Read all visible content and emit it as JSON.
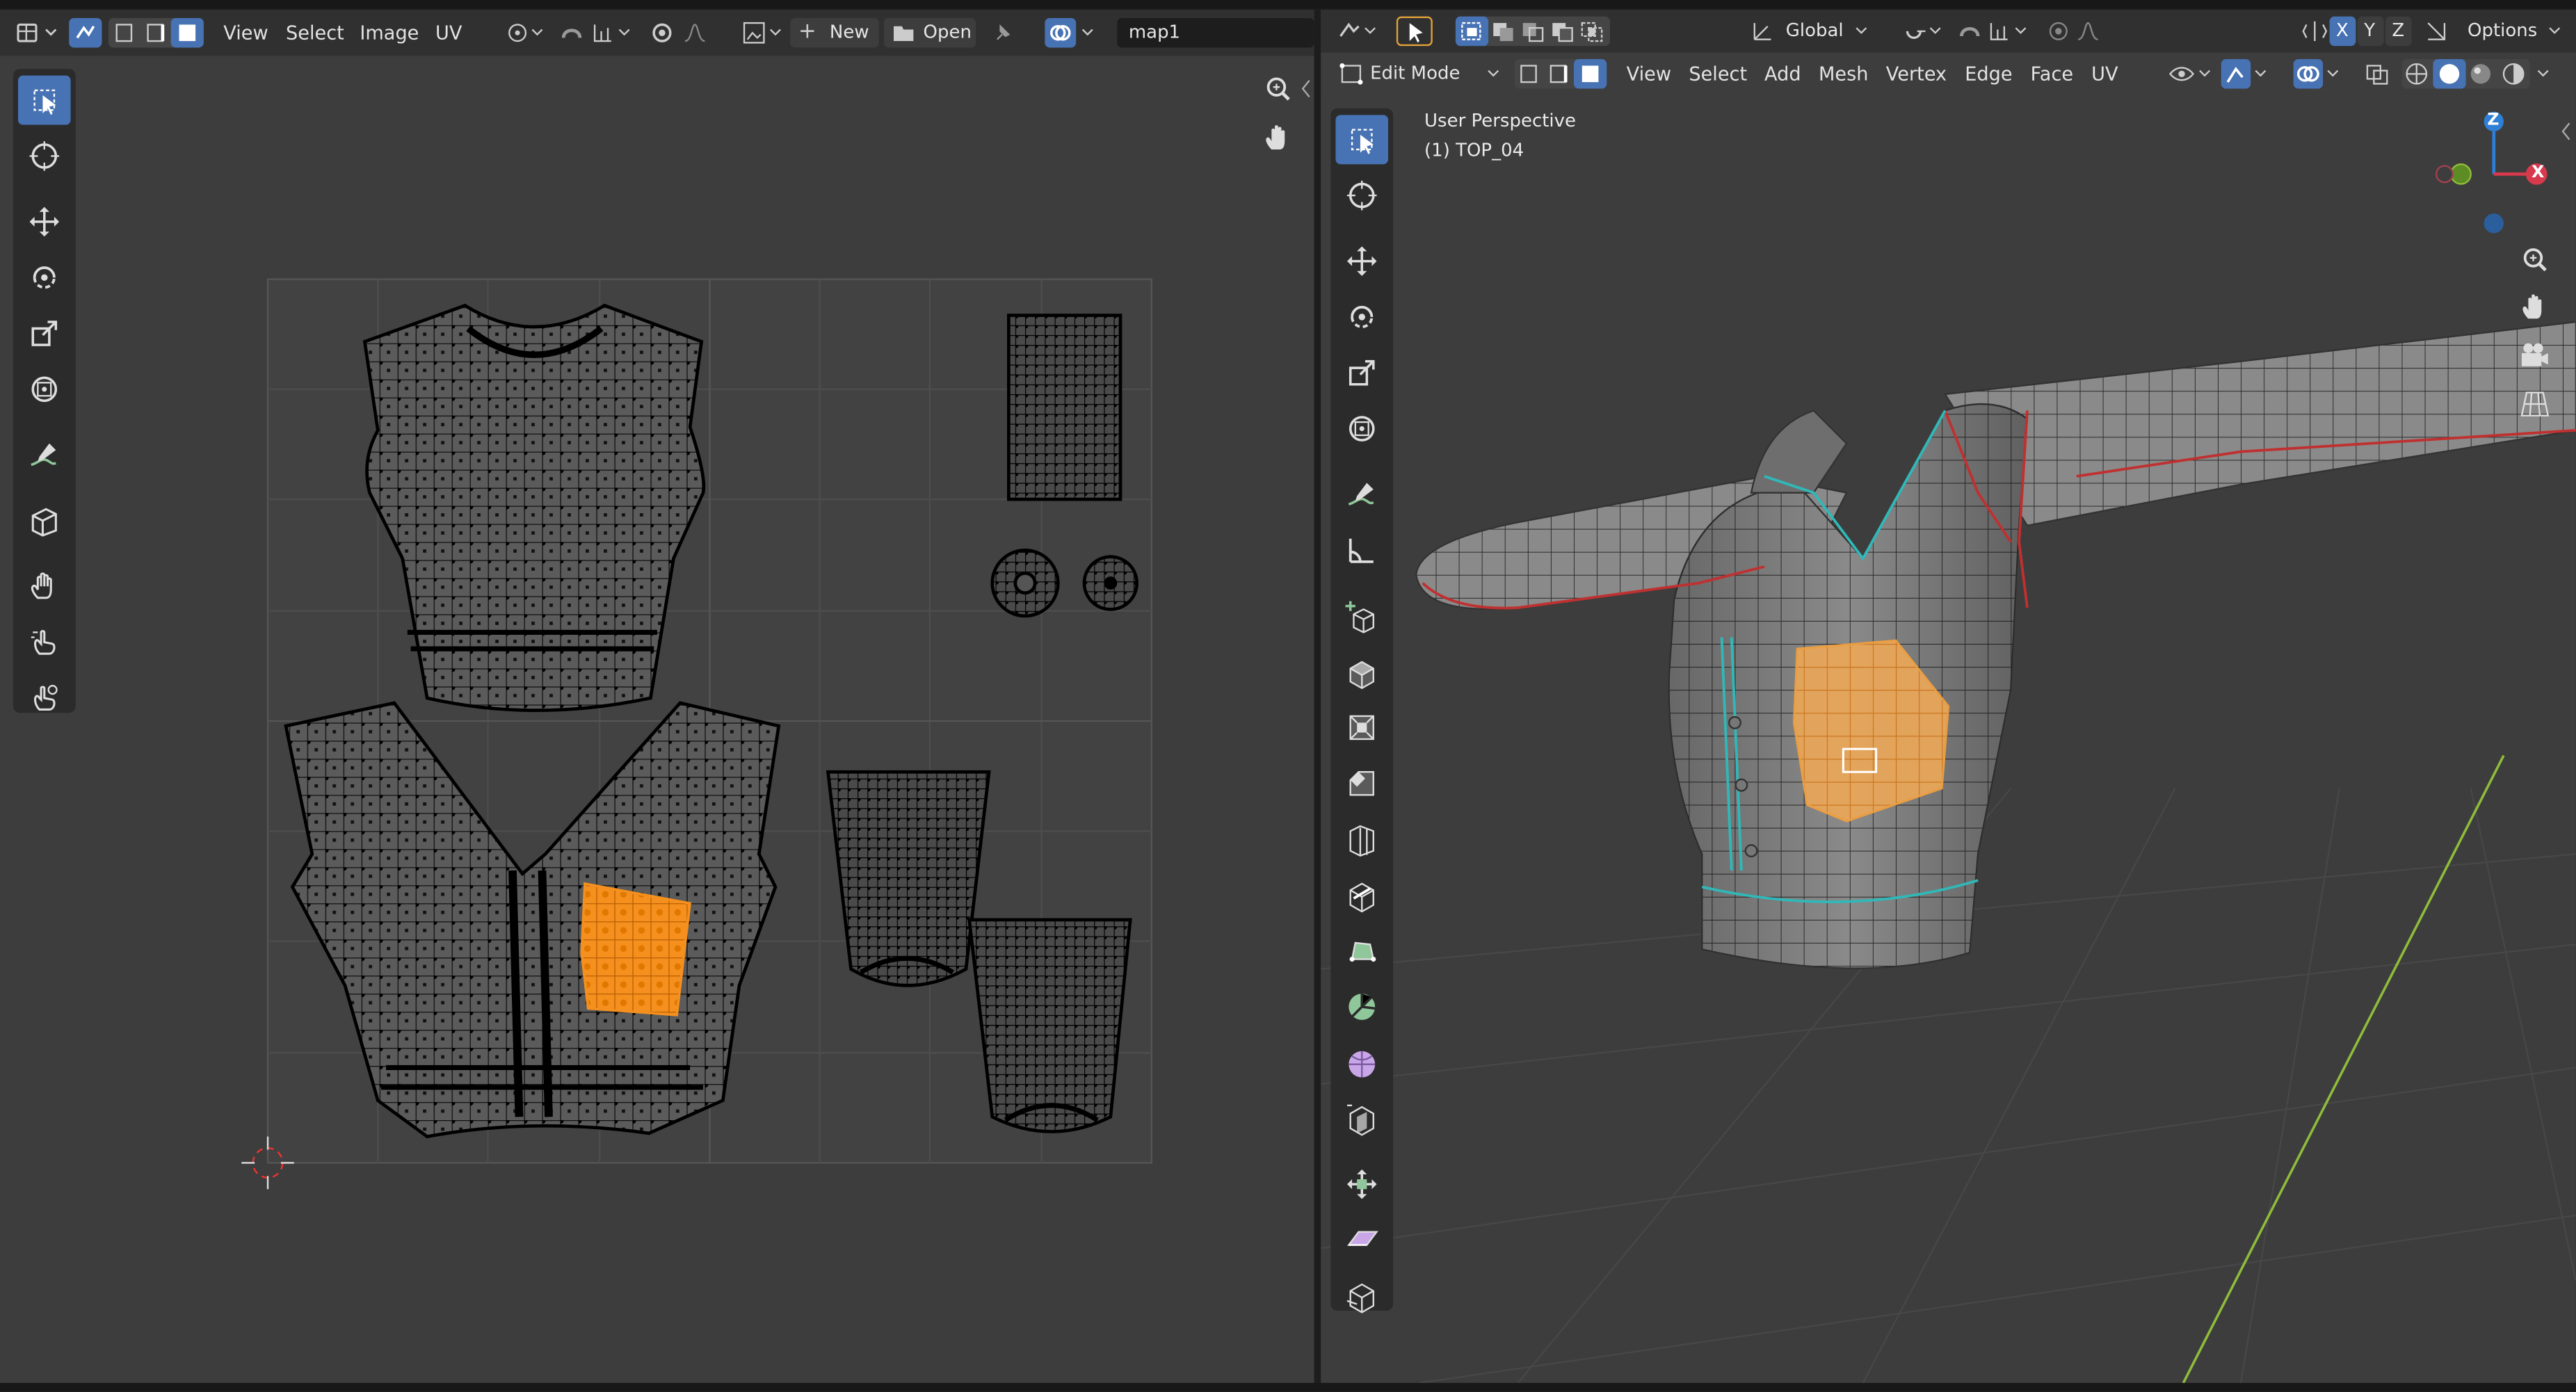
{
  "uv_editor": {
    "menus": [
      "View",
      "Select",
      "Image",
      "UV"
    ],
    "new_label": "New",
    "open_label": "Open",
    "image_name": "map1",
    "tools": [
      "select-box",
      "cursor",
      "move",
      "rotate",
      "scale",
      "transform",
      "annotate",
      "rip-region",
      "grab",
      "relax",
      "pinch"
    ]
  },
  "viewport": {
    "mode_label": "Edit Mode",
    "menus": [
      "View",
      "Select",
      "Add",
      "Mesh",
      "Vertex",
      "Edge",
      "Face",
      "UV"
    ],
    "orientation_label": "Global",
    "axis_x": "X",
    "axis_y": "Y",
    "axis_z": "Z",
    "options_label": "Options",
    "perspective_label": "User Perspective",
    "object_label": "(1) TOP_04",
    "gizmo_z": "Z",
    "gizmo_x": "X",
    "tools": [
      "select-box",
      "cursor",
      "move",
      "rotate",
      "scale",
      "transform",
      "annotate",
      "measure",
      "add-cube",
      "extrude",
      "inset",
      "bevel",
      "loop-cut",
      "knife",
      "poly-build",
      "spin",
      "smooth",
      "edge-slide",
      "shrink-fatten",
      "shear",
      "rip"
    ]
  },
  "colors": {
    "accent_blue": "#4772b3",
    "selection_orange": "#f5901e",
    "seam_red": "#c03030",
    "seam_cyan": "#30b8b8",
    "grid_y_green": "#8fbd3a"
  }
}
